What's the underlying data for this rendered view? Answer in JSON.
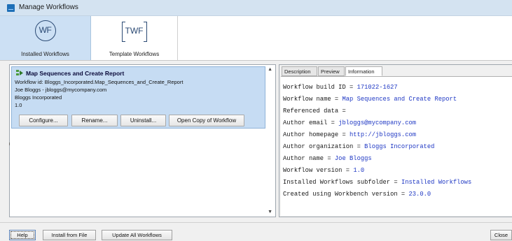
{
  "window": {
    "title": "Manage Workflows"
  },
  "toolbar": {
    "installed": {
      "icon_text": "WF",
      "label": "Installed Workflows"
    },
    "template": {
      "icon_text": "TWF",
      "label": "Template Workflows"
    }
  },
  "workflow_item": {
    "name": "Map Sequences and Create Report",
    "id_line": "Workflow id: Bloggs_Incorporated.Map_Sequences_and_Create_Report",
    "author_line": "Joe Bloggs - jbloggs@mycompany.com",
    "org_line": "Bloggs Incorporated",
    "version_line": "1.0",
    "buttons": {
      "configure": "Configure...",
      "rename": "Rename...",
      "uninstall": "Uninstall...",
      "open_copy": "Open Copy of Workflow"
    }
  },
  "tabs": [
    "Description",
    "Preview",
    "Information"
  ],
  "info": [
    {
      "key": "Workflow build ID = ",
      "value": "171022-1627"
    },
    {
      "key": "Workflow name = ",
      "value": "Map Sequences and Create Report"
    },
    {
      "key": "Referenced data =",
      "value": ""
    },
    {
      "key": "Author email = ",
      "value": "jbloggs@mycompany.com"
    },
    {
      "key": "Author homepage = ",
      "value": "http://jbloggs.com"
    },
    {
      "key": "Author organization = ",
      "value": "Bloggs Incorporated"
    },
    {
      "key": "Author name = ",
      "value": "Joe Bloggs"
    },
    {
      "key": "Workflow version = ",
      "value": "1.0"
    },
    {
      "key": "Installed Workflows subfolder = ",
      "value": "Installed Workflows"
    },
    {
      "key": "Created using Workbench version = ",
      "value": "23.0.0"
    }
  ],
  "footer": {
    "help": "Help",
    "install_from_file": "Install from File",
    "update_all": "Update All Workflows",
    "close": "Close"
  }
}
